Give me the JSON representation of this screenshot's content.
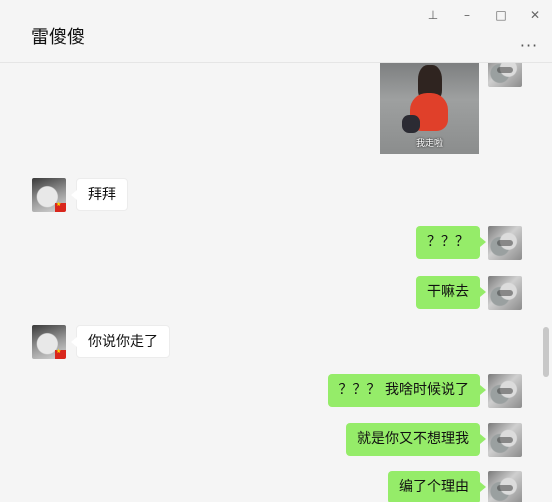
{
  "header": {
    "title": "雷傻傻",
    "controls": {
      "pin": "⊥",
      "minimize": "–",
      "maximize": "□",
      "close": "✕"
    },
    "more": "···"
  },
  "messages": [
    {
      "from": "self",
      "type": "image",
      "caption": "我走啦"
    },
    {
      "from": "other",
      "type": "text",
      "text": "拜拜"
    },
    {
      "from": "self",
      "type": "text",
      "text": "？？？"
    },
    {
      "from": "self",
      "type": "text",
      "text": "干嘛去"
    },
    {
      "from": "other",
      "type": "text",
      "text": "你说你走了"
    },
    {
      "from": "self",
      "type": "text",
      "text": "？？？ 我啥时候说了"
    },
    {
      "from": "self",
      "type": "text",
      "text": "就是你又不想理我"
    },
    {
      "from": "self",
      "type": "text",
      "text": "编了个理由"
    }
  ]
}
